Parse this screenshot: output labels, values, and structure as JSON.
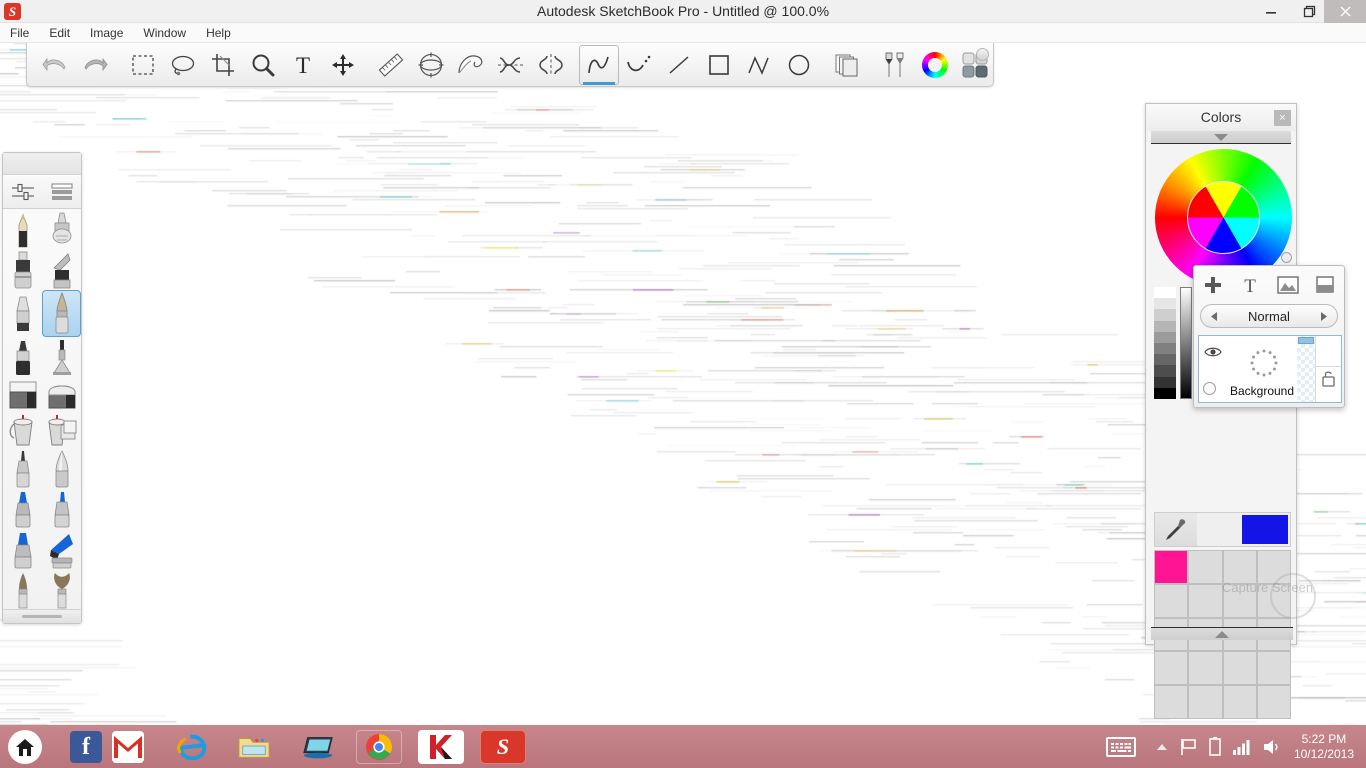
{
  "window": {
    "title": "Autodesk SketchBook Pro - Untitled @ 100.0%",
    "app_logo_glyph": "S",
    "minimize_label": "minimize-icon",
    "maximize_label": "restore-icon",
    "close_label": "×"
  },
  "menu": {
    "items": [
      {
        "label": "File"
      },
      {
        "label": "Edit"
      },
      {
        "label": "Image"
      },
      {
        "label": "Window"
      },
      {
        "label": "Help"
      }
    ]
  },
  "toolbar": {
    "groups": [
      {
        "tools": [
          {
            "name": "undo-tool",
            "icon": "undo-icon",
            "selected": false
          },
          {
            "name": "redo-tool",
            "icon": "redo-icon",
            "selected": false
          }
        ]
      },
      {
        "tools": [
          {
            "name": "rectangle-select-tool",
            "icon": "marquee-icon",
            "selected": false
          },
          {
            "name": "lasso-select-tool",
            "icon": "lasso-icon",
            "selected": false
          },
          {
            "name": "crop-tool",
            "icon": "crop-icon",
            "selected": false
          },
          {
            "name": "zoom-tool",
            "icon": "magnifier-icon",
            "selected": false
          },
          {
            "name": "text-tool",
            "icon": "text-icon",
            "selected": false
          },
          {
            "name": "move-tool",
            "icon": "move-arrows-icon",
            "selected": false
          }
        ]
      },
      {
        "tools": [
          {
            "name": "ruler-tool",
            "icon": "ruler-icon",
            "selected": false
          },
          {
            "name": "ellipse-guide-tool",
            "icon": "ellipse-guide-icon",
            "selected": false
          },
          {
            "name": "french-curve-tool",
            "icon": "french-curve-icon",
            "selected": false
          },
          {
            "name": "symmetry-x-tool",
            "icon": "symmetry-x-icon",
            "selected": false
          },
          {
            "name": "symmetry-y-tool",
            "icon": "symmetry-y-icon",
            "selected": false
          }
        ]
      },
      {
        "tools": [
          {
            "name": "freehand-tool",
            "icon": "freehand-stroke-icon",
            "selected": true
          },
          {
            "name": "curve-tool",
            "icon": "curve-icon",
            "selected": false
          },
          {
            "name": "line-tool",
            "icon": "line-icon",
            "selected": false
          },
          {
            "name": "rectangle-shape-tool",
            "icon": "square-icon",
            "selected": false
          },
          {
            "name": "polyline-tool",
            "icon": "polyline-icon",
            "selected": false
          },
          {
            "name": "ellipse-shape-tool",
            "icon": "circle-icon",
            "selected": false
          }
        ]
      },
      {
        "tools": [
          {
            "name": "layers-tool",
            "icon": "layers-stack-icon",
            "selected": false
          }
        ]
      },
      {
        "tools": [
          {
            "name": "brushes-tool",
            "icon": "pencils-icon",
            "selected": false
          },
          {
            "name": "color-wheel-tool",
            "icon": "color-wheel-icon",
            "selected": false
          },
          {
            "name": "swatch-grid-tool",
            "icon": "swatch-grid-icon",
            "selected": false
          }
        ]
      }
    ]
  },
  "brush_palette": {
    "header_tools": [
      {
        "name": "brush-properties-button",
        "icon": "sliders-icon"
      },
      {
        "name": "brush-list-view-button",
        "icon": "list-rows-icon"
      }
    ],
    "brushes": [
      {
        "name": "pencil-brush",
        "icon": "pencil-icon",
        "selected": false
      },
      {
        "name": "airbrush-brush",
        "icon": "airbrush-icon",
        "selected": false
      },
      {
        "name": "marker-brush",
        "icon": "marker-icon",
        "selected": false
      },
      {
        "name": "chisel-marker-brush",
        "icon": "chisel-marker-icon",
        "selected": false
      },
      {
        "name": "ballpoint-brush",
        "icon": "ballpoint-icon",
        "selected": false
      },
      {
        "name": "soft-brush",
        "icon": "soft-brush-icon",
        "selected": true
      },
      {
        "name": "felt-pen-brush",
        "icon": "felt-pen-icon",
        "selected": false
      },
      {
        "name": "spray-brush",
        "icon": "spray-icon",
        "selected": false
      },
      {
        "name": "eraser-hard-brush",
        "icon": "hard-eraser-icon",
        "selected": false
      },
      {
        "name": "eraser-soft-brush",
        "icon": "soft-eraser-icon",
        "selected": false
      },
      {
        "name": "paint-bucket-brush",
        "icon": "paint-bucket-icon",
        "selected": false
      },
      {
        "name": "gradient-fill-brush",
        "icon": "gradient-fill-icon",
        "selected": false
      },
      {
        "name": "inking-pen-brush",
        "icon": "inking-pen-icon",
        "selected": false
      },
      {
        "name": "steel-nib-brush",
        "icon": "steel-nib-icon",
        "selected": false
      },
      {
        "name": "blue-marker-brush",
        "icon": "blue-marker-icon",
        "selected": false
      },
      {
        "name": "blue-pen-brush",
        "icon": "blue-pen-icon",
        "selected": false
      },
      {
        "name": "blue-chisel-brush",
        "icon": "blue-chisel-icon",
        "selected": false
      },
      {
        "name": "blue-flat-brush",
        "icon": "blue-flat-icon",
        "selected": false
      },
      {
        "name": "bristle-brush",
        "icon": "bristle-brush-icon",
        "selected": false
      },
      {
        "name": "fan-brush",
        "icon": "fan-brush-icon",
        "selected": false
      }
    ]
  },
  "colors_panel": {
    "title": "Colors",
    "close_label": "×",
    "collapse_icon": "chevron-down-icon",
    "expand_icon": "chevron-up-icon",
    "eyedropper_icon": "eyedropper-icon",
    "current_color": "#1414e6",
    "gray_ramp": [
      "#ffffff",
      "#e6e6e6",
      "#cfcfcf",
      "#b5b5b5",
      "#9b9b9b",
      "#808080",
      "#666666",
      "#4d4d4d",
      "#333333",
      "#000000"
    ],
    "swatches": [
      "#ff1493",
      "#dcdcdc",
      "#dcdcdc",
      "#dcdcdc",
      "#dcdcdc",
      "#dcdcdc",
      "#dcdcdc",
      "#dcdcdc",
      "#dcdcdc",
      "#dcdcdc",
      "#dcdcdc",
      "#dcdcdc",
      "#dcdcdc",
      "#dcdcdc",
      "#dcdcdc",
      "#dcdcdc",
      "#dcdcdc",
      "#dcdcdc",
      "#dcdcdc",
      "#dcdcdc"
    ]
  },
  "layers_panel": {
    "toolbar_icons": [
      {
        "name": "add-layer-button",
        "icon": "plus-icon"
      },
      {
        "name": "add-text-layer-button",
        "icon": "text-icon"
      },
      {
        "name": "add-image-layer-button",
        "icon": "image-icon"
      },
      {
        "name": "duplicate-layer-button",
        "icon": "duplicate-layer-icon"
      }
    ],
    "blend_mode": "Normal",
    "prev_icon": "chevron-left-icon",
    "next_icon": "chevron-right-icon",
    "layer": {
      "name": "Background",
      "visibility_icon": "eye-icon",
      "lock_icon": "unlock-icon",
      "thumbnail_icon": "dotted-circle-icon"
    }
  },
  "watermark": {
    "text": "Capture Screen"
  },
  "taskbar": {
    "start": {
      "name": "start-button",
      "icon": "home-icon"
    },
    "apps": [
      {
        "name": "facebook-taskbar-icon",
        "icon": "facebook-icon",
        "glyph": "f",
        "framed": false
      },
      {
        "name": "gmail-taskbar-icon",
        "icon": "gmail-icon",
        "glyph": "M",
        "framed": false
      },
      {
        "name": "internet-explorer-taskbar-icon",
        "icon": "internet-explorer-icon",
        "glyph": "e",
        "framed": false
      },
      {
        "name": "file-explorer-taskbar-icon",
        "icon": "folder-icon",
        "glyph": "",
        "framed": false
      },
      {
        "name": "display-taskbar-icon",
        "icon": "monitor-icon",
        "glyph": "",
        "framed": false
      },
      {
        "name": "chrome-taskbar-icon",
        "icon": "chrome-icon",
        "glyph": "",
        "framed": true
      },
      {
        "name": "kaspersky-taskbar-icon",
        "icon": "kaspersky-icon",
        "glyph": "K",
        "framed": true
      },
      {
        "name": "sketchbook-taskbar-icon",
        "icon": "sketchbook-icon",
        "glyph": "S",
        "framed": true
      }
    ],
    "tray": {
      "keyboard_icon": "keyboard-icon",
      "show_hidden_icon": "chevron-up-icon",
      "action_center_icon": "flag-icon",
      "battery_icon": "battery-icon",
      "network_icon": "signal-bars-icon",
      "volume_icon": "speaker-icon",
      "time": "5:22 PM",
      "date": "10/12/2013"
    }
  }
}
